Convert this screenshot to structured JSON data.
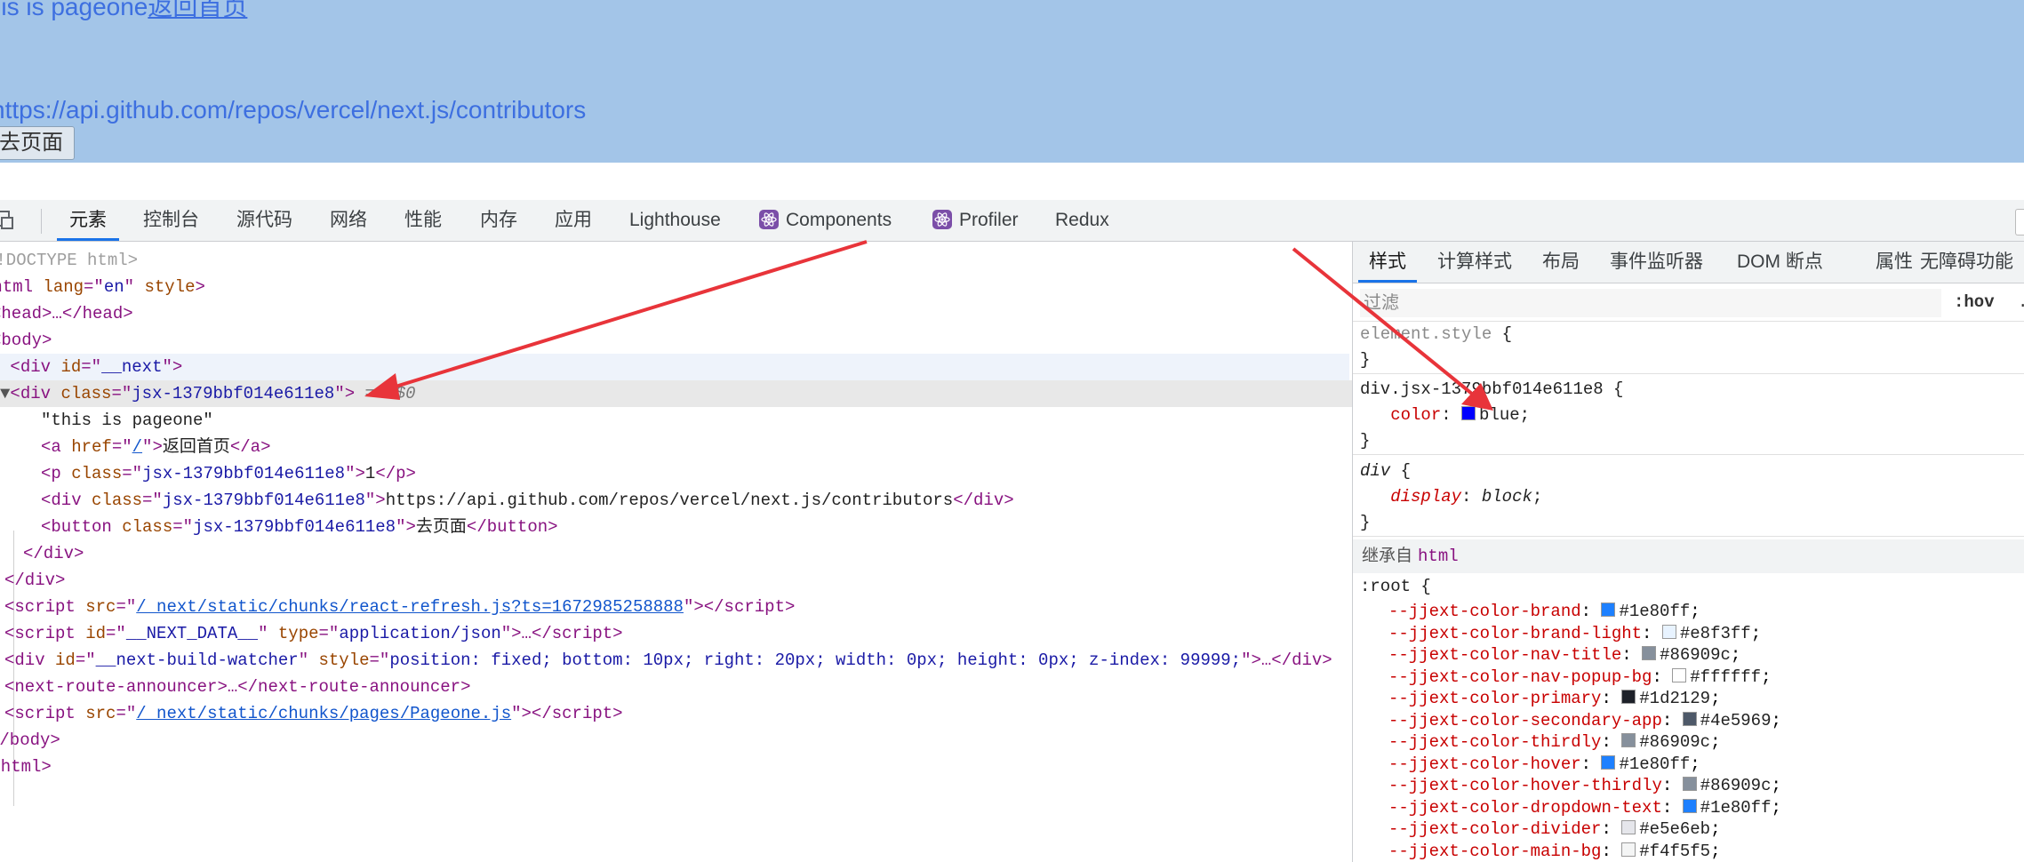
{
  "viewport": {
    "line1_text": "this is pageone",
    "line1_link": "返回首页",
    "url_text": "https://api.github.com/repos/vercel/next.js/contributors",
    "button_label": "去页面"
  },
  "devtools_tabs": [
    {
      "label": "元素",
      "active": true
    },
    {
      "label": "控制台"
    },
    {
      "label": "源代码"
    },
    {
      "label": "网络"
    },
    {
      "label": "性能"
    },
    {
      "label": "内存"
    },
    {
      "label": "应用"
    },
    {
      "label": "Lighthouse"
    },
    {
      "label": "Components",
      "icon": "react-icon"
    },
    {
      "label": "Profiler",
      "icon": "react-icon"
    },
    {
      "label": "Redux"
    }
  ],
  "dom": {
    "doctype": "<!DOCTYPE html>",
    "html_open": {
      "tag": "html",
      "attr1": "lang",
      "val1": "en",
      "attr2": "style"
    },
    "head": "<head>…</head>",
    "body_open": "<body>",
    "div_next": {
      "tag": "div",
      "attr": "id",
      "val": "__next"
    },
    "selected_div": {
      "tag": "div",
      "attr": "class",
      "val": "jsx-1379bbf014e611e8",
      "marker": "== $0"
    },
    "text_node": "\"this is pageone\"",
    "a_node": {
      "href": "/",
      "text": "返回首页"
    },
    "p_node": {
      "class": "jsx-1379bbf014e611e8",
      "text": "1"
    },
    "div_url": {
      "class": "jsx-1379bbf014e611e8",
      "text": "https://api.github.com/repos/vercel/next.js/contributors"
    },
    "button_node": {
      "class": "jsx-1379bbf014e611e8",
      "text": "去页面"
    },
    "script1_src": "/_next/static/chunks/react-refresh.js?ts=1672985258888",
    "script2": {
      "id": "__NEXT_DATA__",
      "type": "application/json"
    },
    "watcher": {
      "id": "__next-build-watcher",
      "style": "position: fixed; bottom: 10px; right: 20px; width: 0px; height: 0px; z-index: 99999;"
    },
    "route_announcer": "<next-route-announcer>…</next-route-announcer>",
    "script3_src": "/_next/static/chunks/pages/Pageone.js",
    "body_close": "</body>",
    "html_close": "</html>"
  },
  "styles_tabs": [
    {
      "label": "样式",
      "active": true
    },
    {
      "label": "计算样式"
    },
    {
      "label": "布局"
    },
    {
      "label": "事件监听器"
    },
    {
      "label": "DOM 断点"
    },
    {
      "label": "属性"
    },
    {
      "label": "无障碍功能"
    }
  ],
  "filter": {
    "placeholder": "过滤",
    "hov": ":hov",
    "cls": ".cls"
  },
  "rules": {
    "element_style": "element.style",
    "jsx_selector": "div.jsx-1379bbf014e611e8",
    "jsx_prop": "color",
    "jsx_value": "blue",
    "jsx_color": "#0000ff",
    "div_selector": "div",
    "div_prop": "display",
    "div_value": "block",
    "inherit_label": "继承自",
    "inherit_tag": "html",
    "root_selector": ":root"
  },
  "root_vars": [
    {
      "name": "--jjext-color-brand",
      "value": "#1e80ff"
    },
    {
      "name": "--jjext-color-brand-light",
      "value": "#e8f3ff"
    },
    {
      "name": "--jjext-color-nav-title",
      "value": "#86909c"
    },
    {
      "name": "--jjext-color-nav-popup-bg",
      "value": "#ffffff"
    },
    {
      "name": "--jjext-color-primary",
      "value": "#1d2129"
    },
    {
      "name": "--jjext-color-secondary-app",
      "value": "#4e5969"
    },
    {
      "name": "--jjext-color-thirdly",
      "value": "#86909c"
    },
    {
      "name": "--jjext-color-hover",
      "value": "#1e80ff"
    },
    {
      "name": "--jjext-color-hover-thirdly",
      "value": "#86909c"
    },
    {
      "name": "--jjext-color-dropdown-text",
      "value": "#1e80ff"
    },
    {
      "name": "--jjext-color-divider",
      "value": "#e5e6eb"
    },
    {
      "name": "--jjext-color-main-bg",
      "value": "#f4f5f5"
    }
  ],
  "annotation_color": "#e8343a"
}
